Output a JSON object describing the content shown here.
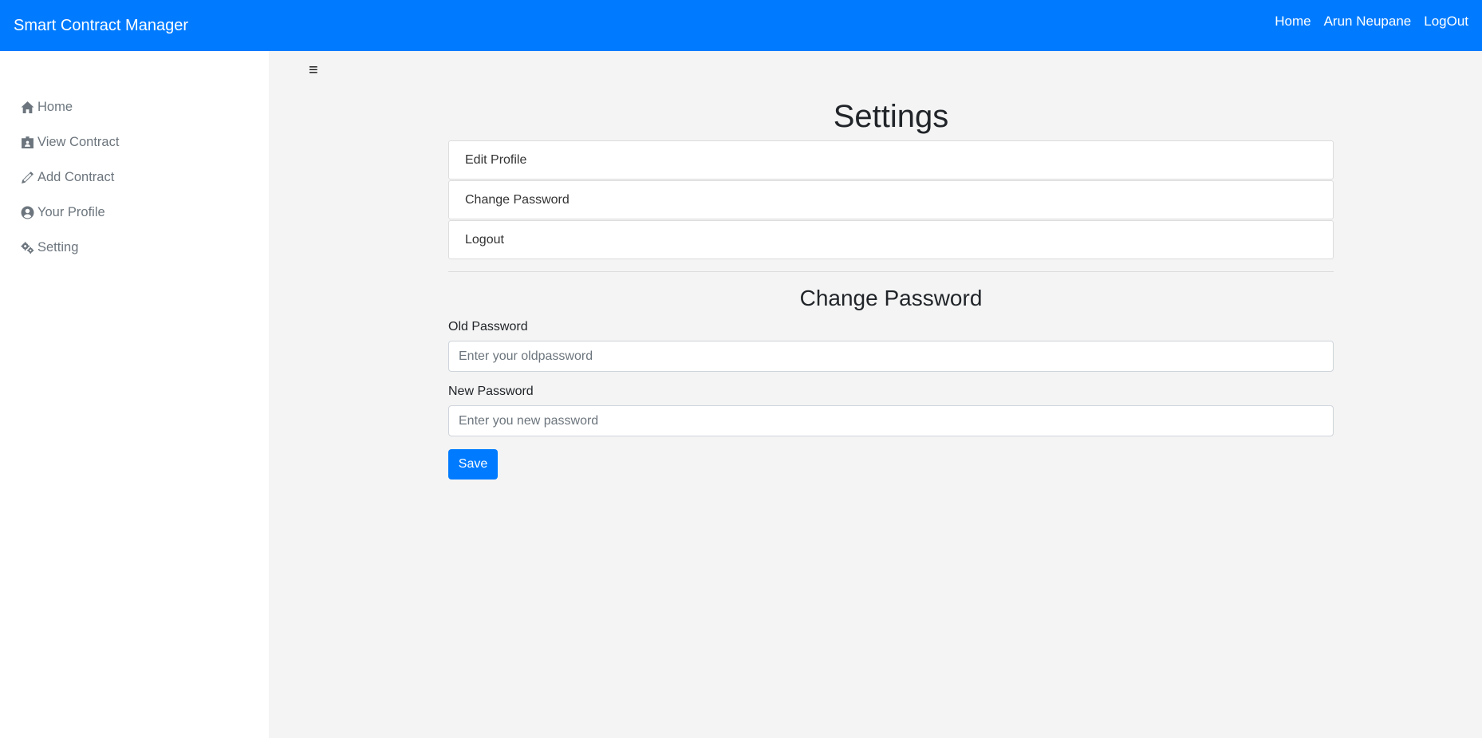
{
  "navbar": {
    "brand": "Smart Contract Manager",
    "links": [
      "Home",
      "Arun Neupane",
      "LogOut"
    ]
  },
  "sidebar": {
    "items": [
      {
        "label": "Home",
        "icon": "home-icon"
      },
      {
        "label": "View Contract",
        "icon": "id-card-icon"
      },
      {
        "label": "Add Contract",
        "icon": "pencil-icon"
      },
      {
        "label": "Your Profile",
        "icon": "user-circle-icon"
      },
      {
        "label": "Setting",
        "icon": "cogs-icon"
      }
    ]
  },
  "main": {
    "menu_icon": "≡",
    "title": "Settings",
    "list": [
      "Edit Profile",
      "Change Password",
      "Logout"
    ],
    "form": {
      "title": "Change Password",
      "old_label": "Old Password",
      "old_placeholder": "Enter your oldpassword",
      "new_label": "New Password",
      "new_placeholder": "Enter you new password",
      "save_label": "Save"
    }
  },
  "colors": {
    "primary": "#007bff",
    "background": "#f4f4f4",
    "sidebar_text": "#6c757d"
  }
}
